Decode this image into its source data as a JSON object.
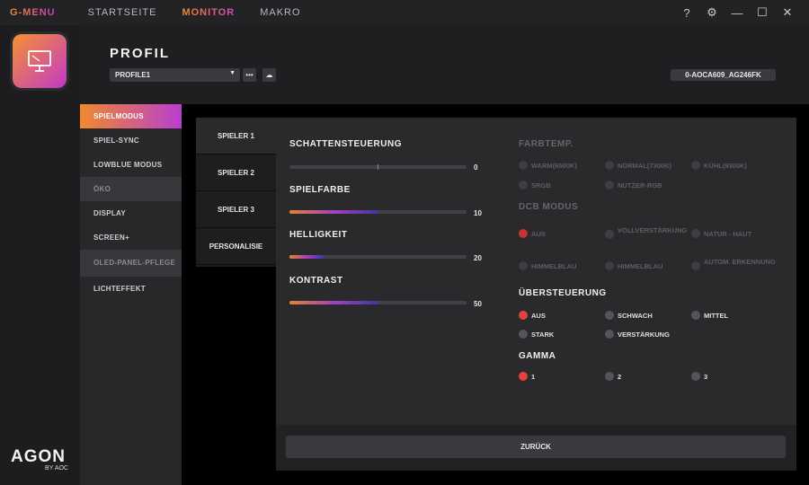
{
  "topbar": {
    "brand": "G-MENU",
    "nav": [
      "STARTSEITE",
      "MONITOR",
      "MAKRO"
    ],
    "controls": [
      "?",
      "⚙",
      "—",
      "☐",
      "✕"
    ]
  },
  "brand_logo": {
    "name": "AGON",
    "by": "BY AOC"
  },
  "header": {
    "title": "PROFIL",
    "profile_select": "PROFILE1",
    "monitor_id": "0-AOCA609_AG246FK"
  },
  "sidebar": {
    "items": [
      "SPIELMODUS",
      "SPIEL-SYNC",
      "LOWBLUE MODUS",
      "ÖKO",
      "DISPLAY",
      "SCREEN+",
      "OLED-PANEL-PFLEGE",
      "LICHTEFFEKT"
    ],
    "active_index": 0
  },
  "tabs": [
    "SPIELER 1",
    "SPIELER 2",
    "SPIELER 3",
    "PERSONALISIE"
  ],
  "sliders": [
    {
      "label": "SCHATTENSTEUERUNG",
      "value": "0",
      "fill": 0
    },
    {
      "label": "SPIELFARBE",
      "value": "10",
      "fill": 0.5
    },
    {
      "label": "HELLIGKEIT",
      "value": "20",
      "fill": 0.2
    },
    {
      "label": "KONTRAST",
      "value": "50",
      "fill": 0.5
    }
  ],
  "farbtemp": {
    "title": "FARBTEMP.",
    "options": [
      "WARM(6500K)",
      "NORMAL(7300K)",
      "KÜHL(9300K)",
      "SRGB",
      "NUTZER-RGB"
    ]
  },
  "dcb": {
    "title": "DCB MODUS",
    "options": [
      "AUS",
      "VOLLVERSTÄRKUNG",
      "NATUR - HAUT",
      "HIMMELBLAU",
      "HIMMELBLAU",
      "AUTOM. ERKENNUNG"
    ]
  },
  "overdrive": {
    "title": "ÜBERSTEUERUNG",
    "options": [
      "AUS",
      "SCHWACH",
      "MITTEL",
      "STARK",
      "VERSTÄRKUNG"
    ]
  },
  "gamma": {
    "title": "GAMMA",
    "options": [
      "1",
      "2",
      "3"
    ]
  },
  "footer": {
    "back_label": "ZURÜCK"
  },
  "colors": {
    "accent_orange": "#f08a2c",
    "accent_purple": "#b83fd0",
    "radio_on": "#e8403a"
  }
}
